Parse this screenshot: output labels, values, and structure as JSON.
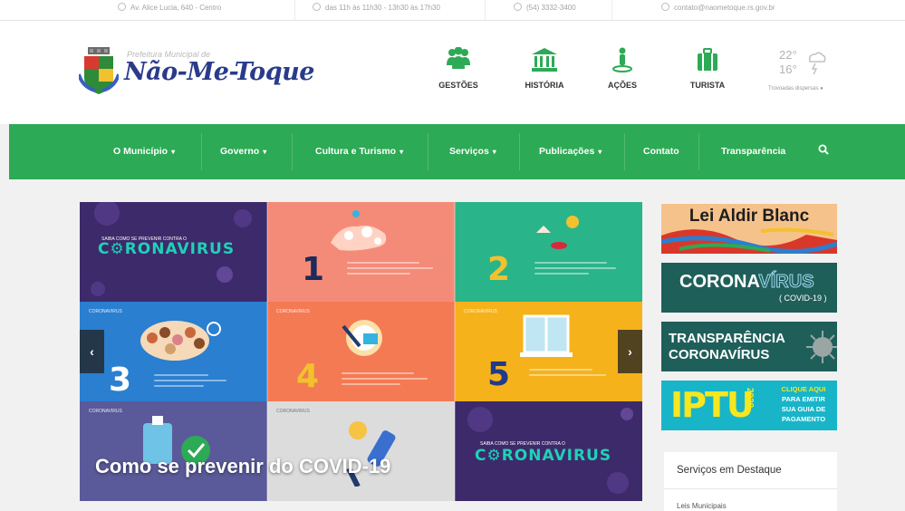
{
  "topbar": {
    "address": "Av. Alice Lucia, 640 - Centro",
    "hours": "das 11h às 11h30 - 13h30 às 17h30",
    "phone": "(54) 3332-3400",
    "email": "contato@naometoque.rs.gov.br"
  },
  "logo": {
    "prefix": "Prefeitura Municipal de",
    "name": "Não-Me-Toque"
  },
  "header_nav": [
    {
      "label": "GESTÕES",
      "icon": "people-icon"
    },
    {
      "label": "HISTÓRIA",
      "icon": "museum-icon"
    },
    {
      "label": "AÇÕES",
      "icon": "person-pin-icon"
    },
    {
      "label": "TURISTA",
      "icon": "suitcase-icon"
    }
  ],
  "weather": {
    "max": "22°",
    "min": "16°",
    "label": "Trovoadas dispersas"
  },
  "nav": [
    {
      "label": "O Município",
      "dropdown": true
    },
    {
      "label": "Governo",
      "dropdown": true
    },
    {
      "label": "Cultura e Turismo",
      "dropdown": true
    },
    {
      "label": "Serviços",
      "dropdown": true
    },
    {
      "label": "Publicações",
      "dropdown": true
    },
    {
      "label": "Contato",
      "dropdown": false
    },
    {
      "label": "Transparência",
      "dropdown": false
    }
  ],
  "slider": {
    "caption": "Como se prevenir do COVID-19",
    "coronavirus_text": "C⚙RONAVIRUS",
    "tile_tag": "CORONAVIRUS",
    "numbers": [
      "1",
      "2",
      "3",
      "4",
      "5"
    ],
    "prev": "‹",
    "next": "›"
  },
  "banners": {
    "aldir": "Lei Aldir Blanc",
    "corona_main": "CORONA",
    "corona_virus": "VÍRUS",
    "corona_sub": "( COVID-19 )",
    "transp_line1": "TRANSPARÊNCIA",
    "transp_line2": "CORONAVÍRUS",
    "iptu": "IPTU",
    "iptu_year": "2020",
    "iptu_cta": [
      "CLIQUE AQUI",
      "PARA EMITIR",
      "SUA GUIA DE",
      "PAGAMENTO"
    ]
  },
  "featured": {
    "title": "Serviços em Destaque",
    "items": [
      "Leis Municipais"
    ]
  },
  "colors": {
    "nav_green": "#2daa55",
    "teal": "#1f5f5a",
    "logo_blue": "#2a3b8a"
  }
}
